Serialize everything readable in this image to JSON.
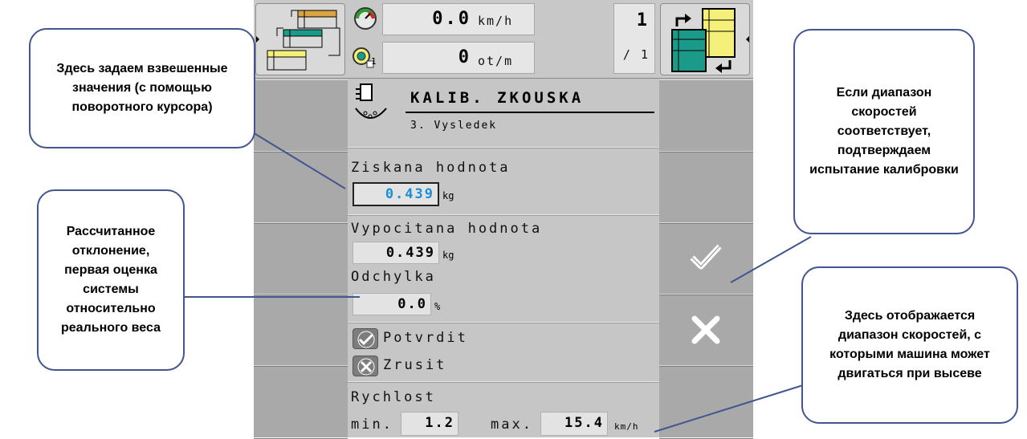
{
  "header": {
    "speed_value": "0.0",
    "speed_unit": "km/h",
    "rpm_value": "0",
    "rpm_unit": "ot/m",
    "rpm_index": "1",
    "page_current": "1",
    "page_total": "/ 1"
  },
  "panel": {
    "title": "KALIB. ZKOUSKA",
    "subtitle": "3. Vysledek",
    "obtained_label": "Ziskana hodnota",
    "obtained_value": "0.439",
    "obtained_unit": "kg",
    "calculated_label": "Vypocitana hodnota",
    "calculated_value": "0.439",
    "calculated_unit": "kg",
    "deviation_label": "Odchylka",
    "deviation_value": "0.0",
    "deviation_unit": "%",
    "confirm_label": "Potvrdit",
    "cancel_label": "Zrusit",
    "speed_label": "Rychlost",
    "min_label": "min.",
    "min_value": "1.2",
    "max_label": "max.",
    "max_value": "15.4",
    "speed_unit": "km/h"
  },
  "callouts": {
    "weighed": "Здесь задаем взвешенные значения (с помощью поворотного курсора)",
    "deviation": "Рассчитанное отклонение, первая оценка системы относительно реального веса",
    "confirm": "Если диапазон скоростей соответствует, подтверждаем испытание калибровки",
    "speed_range": "Здесь отображается диапазон скоростей, с которыми машина может двигаться при высеве"
  },
  "colors": {
    "accent_value": "#1a8fd6",
    "callout_border": "#42558f",
    "teal": "#1b9a8a",
    "yellow": "#f4f07a",
    "orange": "#d9a441"
  },
  "icons": [
    "sequence-icon",
    "speedometer-icon",
    "rpm-sensor-icon",
    "page-swap-icon",
    "calibration-scale-icon",
    "checkmark-icon",
    "cross-icon"
  ]
}
